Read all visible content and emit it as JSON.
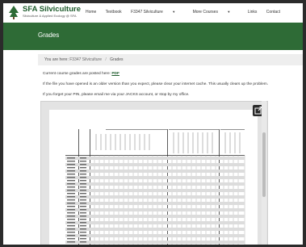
{
  "site": {
    "brand": "SFA Silviculture",
    "tagline": "Silviculture & Applied Ecology @ SFA"
  },
  "nav": {
    "items": [
      "Home",
      "Textbook",
      "F3347 Silviculture",
      "More Courses",
      "Links",
      "Contact"
    ]
  },
  "banner": {
    "title": "Grades"
  },
  "breadcrumb": {
    "prefix": "You are here:",
    "course": "F3347 Silviculture",
    "separator": "/",
    "current": "Grades"
  },
  "content": {
    "line1_text": "Current course grades are posted here:",
    "line1_link": "PDF",
    "line2": "If the file you have opened is an older version than you expect, please clear your internet cache. This usually clears up the problem.",
    "line3": "If you forget your PIN, please email me via your JACKS account, or stop by my office."
  },
  "viewer": {
    "popout_icon": "external-link-icon"
  },
  "colors": {
    "brand_green": "#2e6b36",
    "link_green": "#1e5b2c"
  }
}
